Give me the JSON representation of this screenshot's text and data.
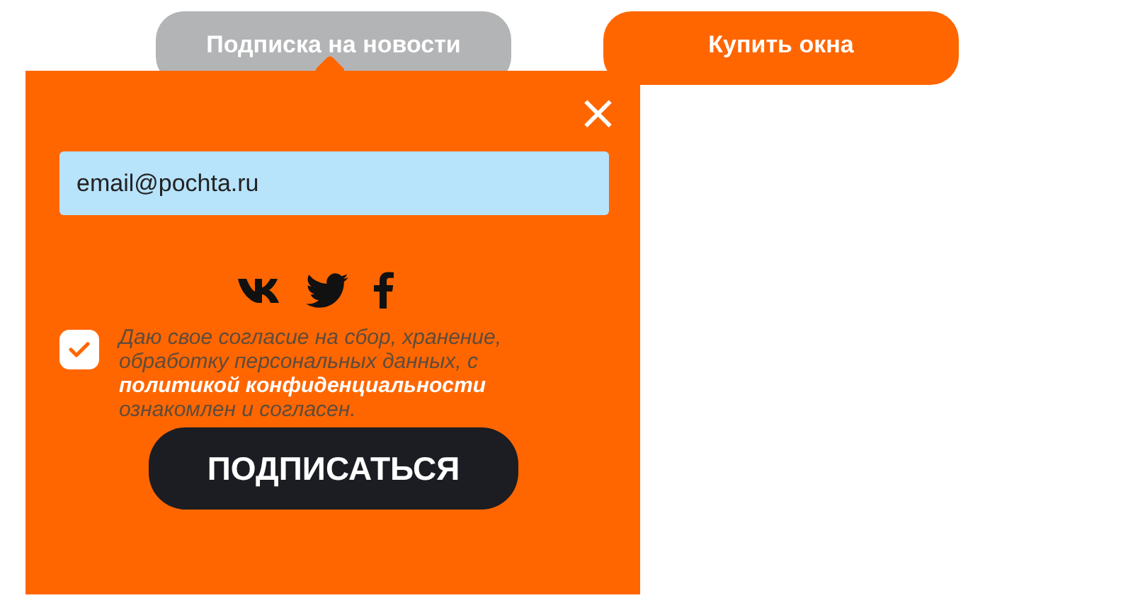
{
  "tabs": [
    {
      "label": "Подписка на новости",
      "selected": true
    },
    {
      "label": "Купить окна",
      "selected": false
    }
  ],
  "popup": {
    "close": "×",
    "email": {
      "value": "email@pochta.ru"
    },
    "social": [
      {
        "kind": "vk"
      },
      {
        "kind": "twitter"
      },
      {
        "kind": "facebook"
      }
    ],
    "consent": {
      "checked": true,
      "text_before": "Даю свое согласие на сбор, хранение, обработку персональных данных, с",
      "link": "политикой конфиденциальности",
      "text_after": "ознакомлен и согласен."
    },
    "submit": "ПОДПИСАТЬСЯ"
  }
}
